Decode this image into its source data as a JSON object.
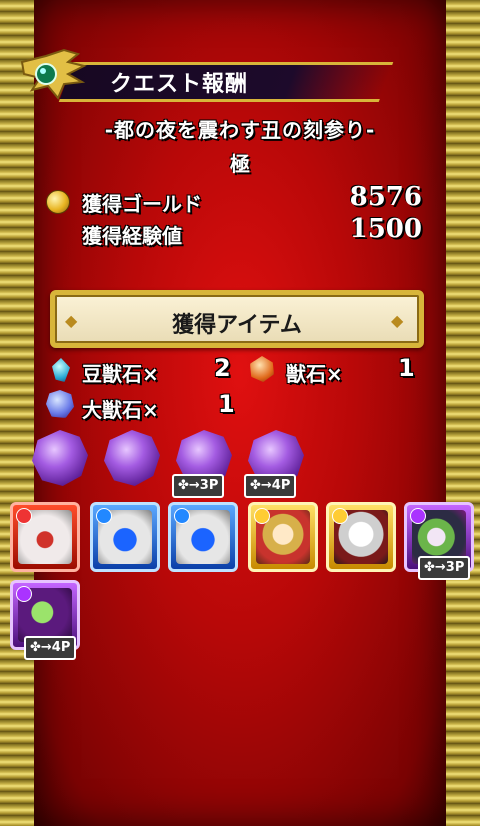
{
  "header": {
    "title": "クエスト報酬",
    "quest_name": "-都の夜を震わす丑の刻参り-",
    "difficulty": "極"
  },
  "rewards": {
    "gold_label": "獲得ゴールド",
    "gold_value": "8576",
    "exp_label": "獲得経験値",
    "exp_value": "1500"
  },
  "items": {
    "header_label": "獲得アイテム",
    "stones": [
      {
        "label": "豆獣石×",
        "count": "2"
      },
      {
        "label": "獣石×",
        "count": "1"
      },
      {
        "label": "大獣石×",
        "count": "1"
      }
    ],
    "purple_stone_bonus": [
      "",
      "",
      "✤→3P",
      "✤→4P"
    ],
    "monster_bonus": [
      "",
      "",
      "",
      "",
      "",
      "✤→3P",
      "✤→4P"
    ]
  },
  "colors": {
    "panel": "#c00808",
    "gold_border": "#d8b53a",
    "fire": "#ff4d2b",
    "water": "#5aa8ff",
    "light": "#ffe066",
    "dark": "#c466ff"
  },
  "icons": [
    "gold-coin-icon",
    "small-beast-stone-icon",
    "beast-stone-icon",
    "large-beast-stone-icon",
    "clover-icon",
    "emblem-icon"
  ]
}
